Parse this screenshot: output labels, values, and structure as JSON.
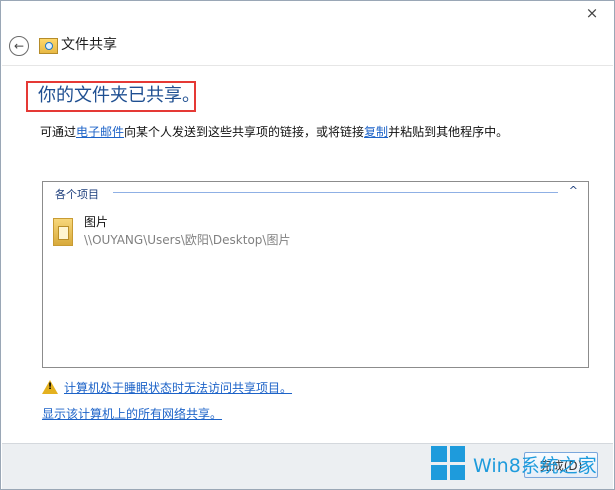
{
  "window": {
    "title": "文件共享",
    "close_label": "×",
    "back_label": "←"
  },
  "content": {
    "headline": "你的文件夹已共享。",
    "desc_prefix": "可通过",
    "desc_email_link": "电子邮件",
    "desc_middle": "向某个人发送到这些共享项的链接，或将链接",
    "desc_copy_link": "复制",
    "desc_suffix": "并粘贴到其他程序中。"
  },
  "panel": {
    "header": "各个项目",
    "toggle": "^",
    "items": [
      {
        "name": "图片",
        "path": "\\\\OUYANG\\Users\\欧阳\\Desktop\\图片",
        "icon": "folder-icon"
      }
    ]
  },
  "links": {
    "warning": "计算机处于睡眠状态时无法访问共享项目。",
    "network_shares": "显示该计算机上的所有网络共享。"
  },
  "footer": {
    "done_label": "完成(D)"
  },
  "watermark": {
    "text": "Win8系统之家"
  }
}
